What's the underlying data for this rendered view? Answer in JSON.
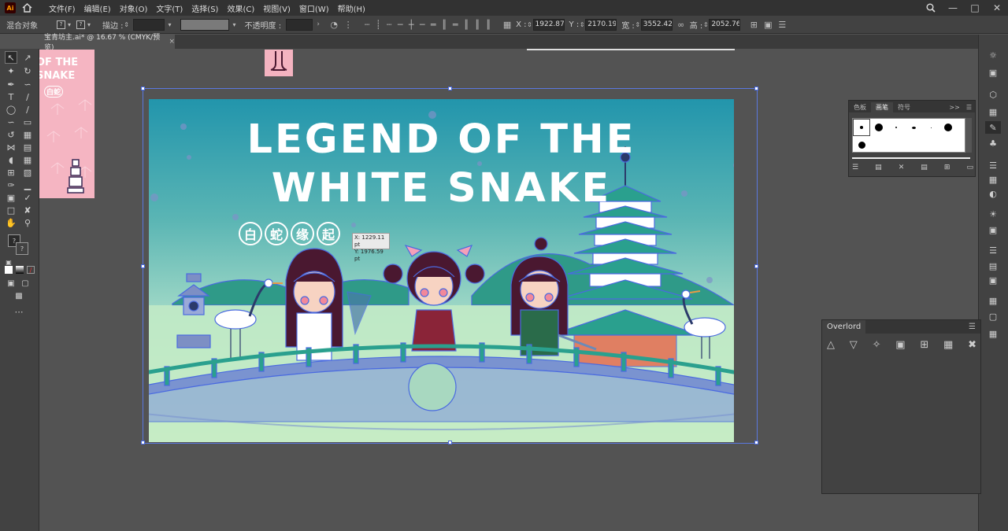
{
  "app": {
    "logo": "Ai"
  },
  "menu": {
    "items": [
      "文件(F)",
      "编辑(E)",
      "对象(O)",
      "文字(T)",
      "选择(S)",
      "效果(C)",
      "视图(V)",
      "窗口(W)",
      "帮助(H)"
    ]
  },
  "control": {
    "selection_label": "混合对象",
    "stroke_label": "描边 :",
    "opacity_label": "不透明度 :",
    "x_label": "X :",
    "x_value": "1922.8788",
    "y_label": "Y :",
    "y_value": "2170.1936",
    "w_label": "宽 :",
    "w_value": "3552.4289",
    "h_label": "高 :",
    "h_value": "2052.7626"
  },
  "document": {
    "tab_title": "宝青坊主.ai* @ 16.67 % (CMYK/预览)",
    "tab_close": "×"
  },
  "brush_panel": {
    "tabs": [
      "色板",
      "画笔",
      "符号"
    ],
    "active_tab": "画笔",
    "menu_glyph": ">>"
  },
  "overlord_panel": {
    "title": "Overlord"
  },
  "artwork": {
    "title_line1": "LEGEND OF THE",
    "title_line2": "WHITE SNAKE",
    "cn_chars": [
      "白",
      "蛇",
      "缘",
      "起"
    ],
    "left_art_line1": "OF THE",
    "left_art_line2": "SNAKE",
    "left_art_cn": "白蛇"
  },
  "tooltip": {
    "x": "X: 1229.11 pt",
    "y": "Y: 1976.59 pt"
  },
  "colors": {
    "accent": "#4a6ae0",
    "teal": "#2295ac",
    "pink": "#f5b5c2",
    "maroon": "#4a1830"
  }
}
